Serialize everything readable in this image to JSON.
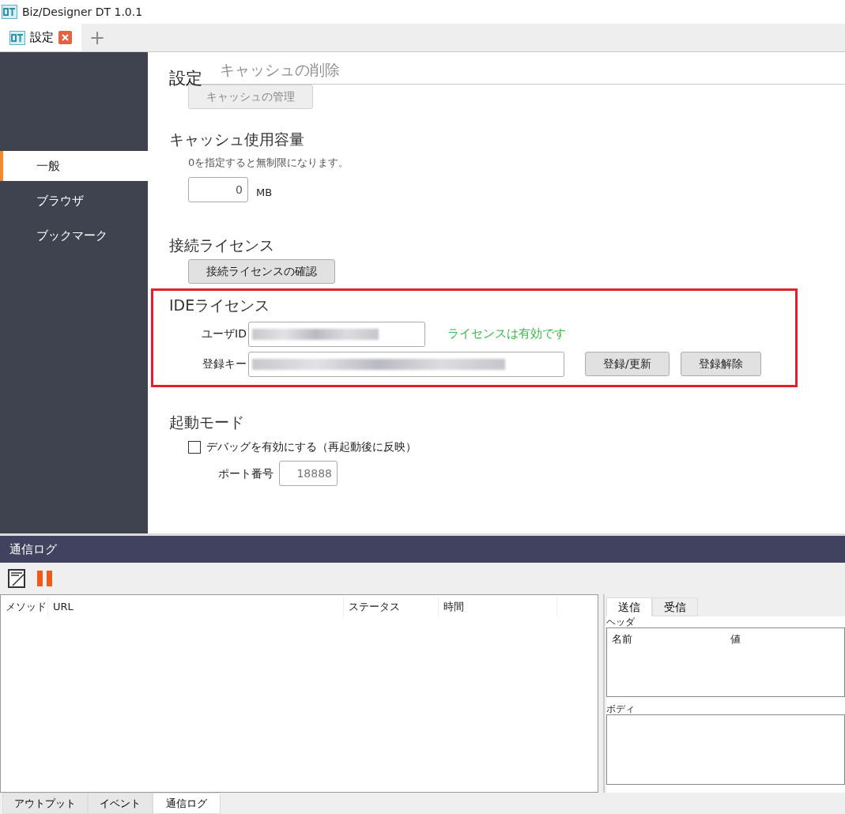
{
  "window": {
    "title": "Biz/Designer DT 1.0.1"
  },
  "doc_tabs": [
    {
      "label": "設定",
      "selected": true
    }
  ],
  "new_tab": "+",
  "sidebar": {
    "items": [
      {
        "label": "一般",
        "selected": true
      },
      {
        "label": "ブラウザ",
        "selected": false
      },
      {
        "label": "ブックマーク",
        "selected": false
      }
    ]
  },
  "settings": {
    "title": "設定",
    "sections": [
      {
        "kind": "faded",
        "heading": "キャッシュの削除",
        "button": "キャッシュの管理"
      },
      {
        "kind": "number",
        "heading": "キャッシュ使用容量",
        "hint": "0を指定すると無制限になります。",
        "value": "0",
        "unit": "MB"
      },
      {
        "kind": "button",
        "heading": "接続ライセンス",
        "button": "接続ライセンスの確認"
      },
      {
        "kind": "license",
        "highlighted": true,
        "heading": "IDEライセンス",
        "user_label": "ユーザID",
        "status": "ライセンスは有効です",
        "key_label": "登録キー",
        "buttons": [
          "登録/更新",
          "登録解除"
        ]
      },
      {
        "kind": "startup",
        "heading": "起動モード",
        "checkbox": {
          "label": "デバッグを有効にする（再起動後に反映）",
          "checked": false
        },
        "port_label": "ポート番号",
        "port_placeholder": "18888"
      }
    ]
  },
  "log_panel": {
    "title": "通信ログ",
    "columns": [
      "メソッド",
      "URL",
      "ステータス",
      "時間"
    ],
    "detail_tabs": [
      {
        "label": "送信",
        "selected": true
      },
      {
        "label": "受信",
        "selected": false
      }
    ],
    "header_label": "ヘッダ",
    "header_columns": [
      "名前",
      "値"
    ],
    "body_label": "ボディ"
  },
  "bottom_tabs": [
    {
      "label": "アウトプット",
      "selected": false
    },
    {
      "label": "イベント",
      "selected": false
    },
    {
      "label": "通信ログ",
      "selected": true
    }
  ]
}
